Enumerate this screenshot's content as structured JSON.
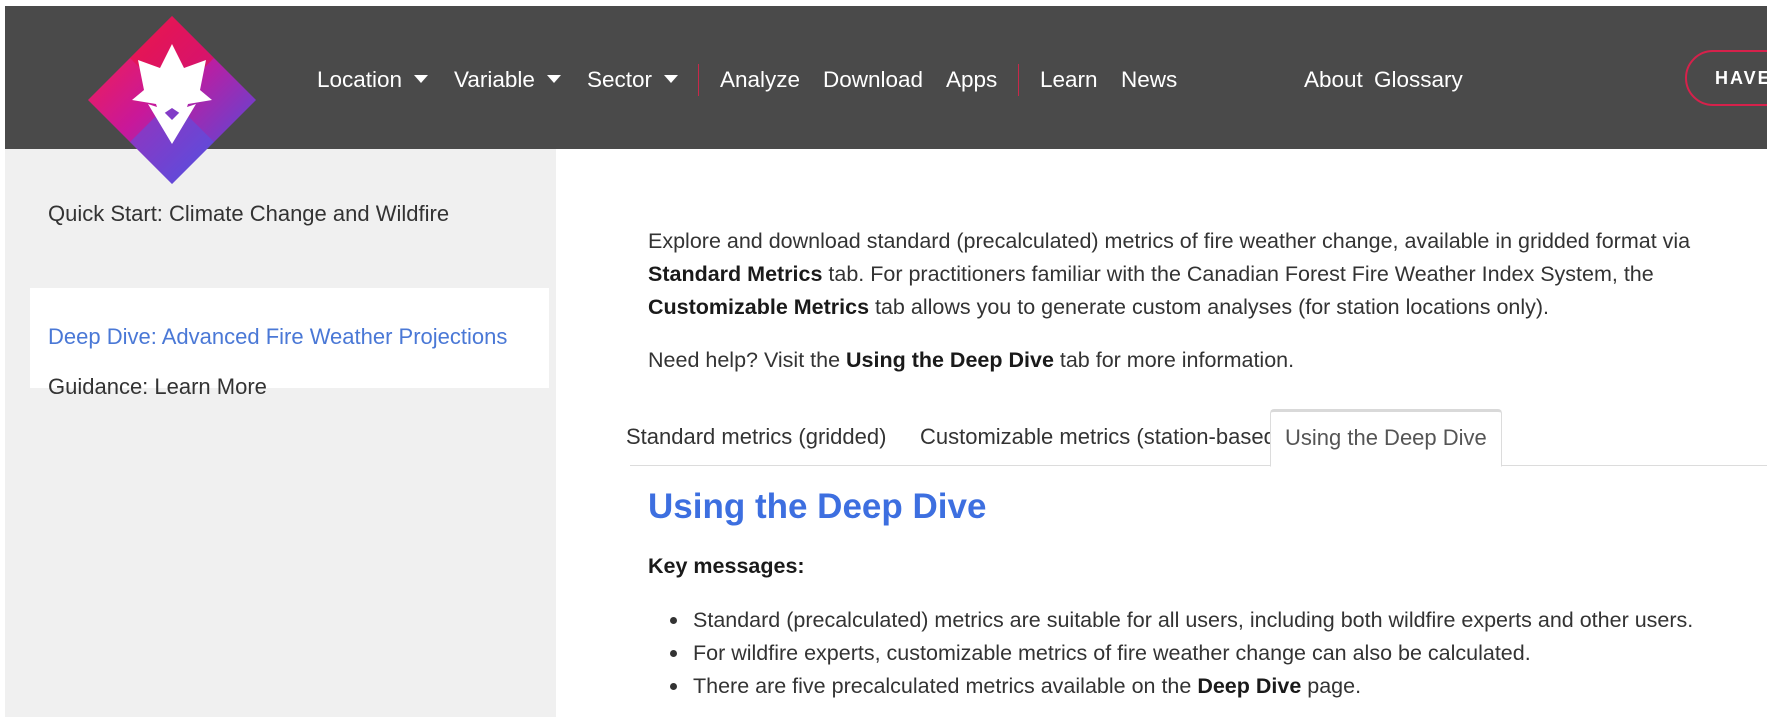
{
  "nav": {
    "location": "Location",
    "variable": "Variable",
    "sector": "Sector",
    "analyze": "Analyze",
    "download": "Download",
    "apps": "Apps",
    "learn": "Learn",
    "news": "News",
    "about": "About",
    "glossary": "Glossary",
    "have_button": "HAVE A"
  },
  "sidebar": {
    "items": [
      {
        "label": "Quick Start: Climate Change and Wildfire"
      },
      {
        "label": "Deep Dive: Advanced Fire Weather Projections"
      },
      {
        "label": "Guidance: Learn More"
      }
    ]
  },
  "main": {
    "intro": {
      "line1": "Explore and download standard (precalculated) metrics of fire weather change, available in gridded format via",
      "line2_bold": "Standard Metrics",
      "line2_rest": " tab. For practitioners familiar with the Canadian Forest Fire Weather Index System, the",
      "line3_bold": "Customizable Metrics",
      "line3_rest": " tab allows you to generate custom analyses (for station locations only)."
    },
    "help": {
      "pre": "Need help? Visit the ",
      "bold": "Using the Deep Dive",
      "post": " tab for more information."
    },
    "tabs": [
      {
        "label": "Standard metrics (gridded)"
      },
      {
        "label": "Customizable metrics (station-based)"
      },
      {
        "label": "Using the Deep Dive"
      }
    ],
    "section_title": "Using the Deep Dive",
    "key_messages_label": "Key messages:",
    "bullets": {
      "b1": "Standard (precalculated) metrics are suitable for all users, including both wildfire experts and other users.",
      "b2": "For wildfire experts, customizable metrics of fire weather change can also be calculated.",
      "b3_pre": "There are five precalculated metrics available on the ",
      "b3_bold": "Deep Dive",
      "b3_post": " page."
    }
  },
  "colors": {
    "nav_bg": "#4a4a4a",
    "accent_red": "#d6214b",
    "link_blue": "#4a78d6",
    "title_blue": "#3d6fe0",
    "sidebar_bg": "#f0f0f0"
  }
}
